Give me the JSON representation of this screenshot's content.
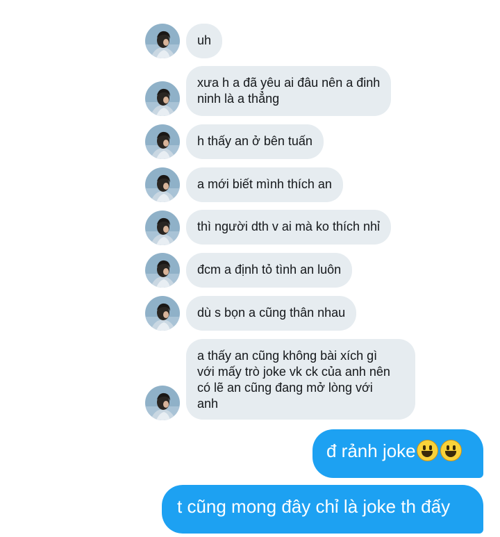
{
  "conversation": {
    "incoming": [
      {
        "text": "uh"
      },
      {
        "text": "xưa h a đã yêu ai đâu nên a đinh\nninh là a thẳng"
      },
      {
        "text": "h thấy an ở bên tuấn"
      },
      {
        "text": "a mới biết mình thích an"
      },
      {
        "text": "thì người dth v ai mà ko thích nhỉ"
      },
      {
        "text": "đcm a định tỏ tình an luôn"
      },
      {
        "text": "dù s bọn a cũng thân nhau"
      },
      {
        "text": "a thấy an cũng không bài xích gì\nvới mấy trò joke vk ck của anh nên\ncó lẽ an cũng đang mở lòng với\nanh"
      }
    ],
    "outgoing": [
      {
        "text": "đ rảnh joke",
        "emojis": [
          "grinning-face-icon",
          "grinning-face-icon"
        ]
      },
      {
        "text": "t cũng mong đây chỉ là joke th đấy"
      }
    ]
  },
  "colors": {
    "incoming_bubble": "#e6ecf0",
    "outgoing_bubble": "#1da1f2",
    "incoming_text": "#14171a",
    "outgoing_text": "#ffffff"
  }
}
